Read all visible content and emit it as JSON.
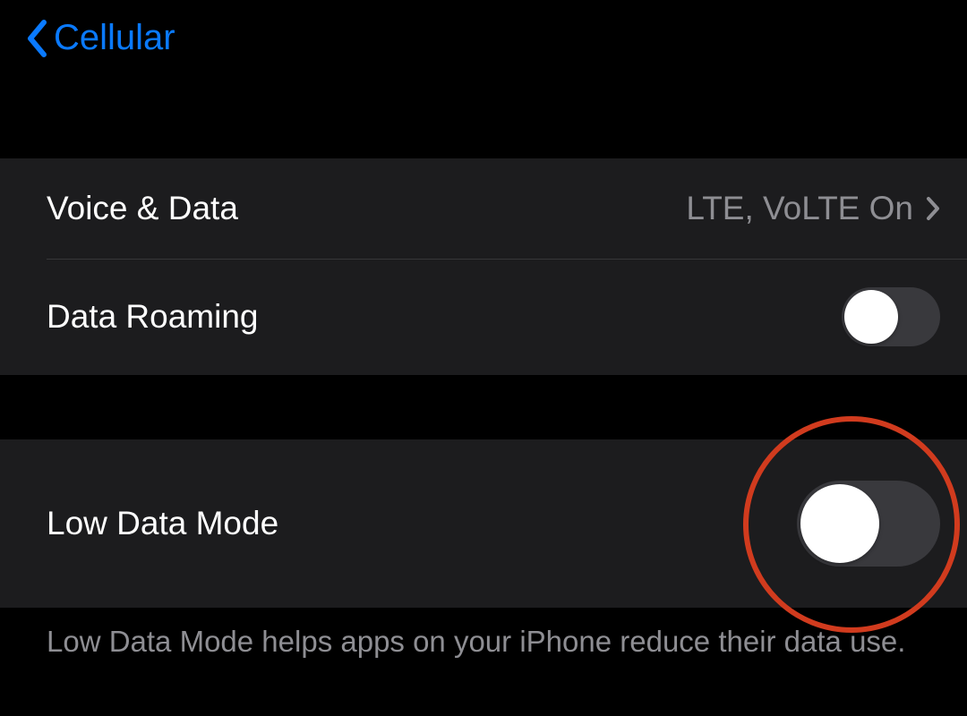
{
  "nav": {
    "back_label": "Cellular"
  },
  "groups": {
    "voice_data": {
      "label": "Voice & Data",
      "value": "LTE, VoLTE On"
    },
    "data_roaming": {
      "label": "Data Roaming",
      "toggle": "off"
    },
    "low_data_mode": {
      "label": "Low Data Mode",
      "toggle": "off",
      "footer": "Low Data Mode helps apps on your iPhone reduce their data use."
    }
  }
}
